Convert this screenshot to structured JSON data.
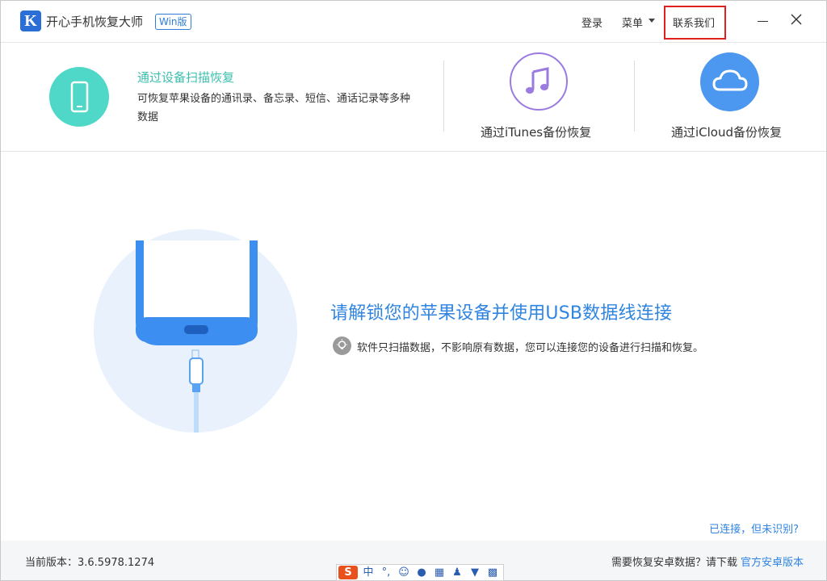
{
  "app": {
    "logo_letter": "K",
    "title": "开心手机恢复大师",
    "badge": "Win版",
    "brand_color": "#2b6fd6"
  },
  "header": {
    "login_label": "登录",
    "menu_label": "菜单",
    "contact_label": "联系我们"
  },
  "modes": {
    "device_scan": {
      "title": "通过设备扫描恢复",
      "description": "可恢复苹果设备的通讯录、备忘录、短信、通话记录等多种数据",
      "icon": "phone-icon",
      "color": "#4fd7c8"
    },
    "itunes": {
      "label": "通过iTunes备份恢复",
      "icon": "music-note-icon",
      "color": "#9b7bdf"
    },
    "icloud": {
      "label": "通过iCloud备份恢复",
      "icon": "cloud-icon",
      "color": "#4c98f0"
    }
  },
  "main": {
    "headline": "请解锁您的苹果设备并使用USB数据线连接",
    "tip": "软件只扫描数据，不影响原有数据，您可以连接您的设备进行扫描和恢复。",
    "not_recognized_link": "已连接，但未识别?",
    "accent_color": "#2f84e0"
  },
  "footer": {
    "version": "当前版本：3.6.5978.1274",
    "android_question": "需要恢复安卓数据？请下载",
    "android_link": "官方安卓版本"
  },
  "ime": {
    "logo": "S",
    "chinese": "中",
    "punct": "°,"
  }
}
